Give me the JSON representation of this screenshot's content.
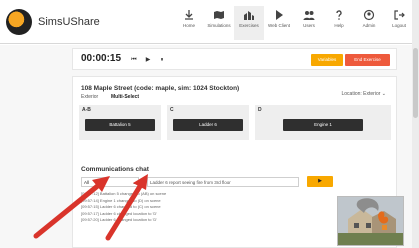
{
  "app": {
    "brand": "SimsUShare"
  },
  "nav": {
    "items": [
      {
        "label": "Home",
        "icon": "download-icon"
      },
      {
        "label": "Simulations",
        "icon": "map-icon"
      },
      {
        "label": "Exercises",
        "icon": "buildings-icon",
        "active": true
      },
      {
        "label": "Web Client",
        "icon": "play-icon"
      },
      {
        "label": "Users",
        "icon": "users-icon"
      },
      {
        "label": "Help",
        "icon": "help-icon"
      },
      {
        "label": "Admin",
        "icon": "admin-icon"
      },
      {
        "label": "Logout",
        "icon": "logout-icon"
      }
    ]
  },
  "timer": {
    "time": "00:00:15",
    "controls": {
      "rewind": "⏮",
      "play": "▶",
      "pause": "⏸"
    },
    "variables_label": "Variables",
    "end_label": "End Exercise"
  },
  "scenario": {
    "title": "108 Maple Street (code: maple, sim: 1024 Stockton)",
    "tabs": [
      "Exterior",
      "Multi-Select"
    ],
    "location_label": "Location: Exterior",
    "columns": [
      {
        "header": "A-B",
        "unit": "Battalion 5"
      },
      {
        "header": "C",
        "unit": "Ladder 6"
      },
      {
        "header": "D",
        "unit": "Engine 1"
      }
    ]
  },
  "chat": {
    "title": "Communications chat",
    "recipient": "All",
    "input_value": "Ladder 6 report seeing fire from 3rd floor",
    "send_label": "▶",
    "messages": [
      "[09:57:12] Battalion 5 changed to (AB) on scene",
      "[09:57:14] Engine 1 changed to (D) on scene",
      "[09:57:15] Ladder 6 changed to (C) on scene",
      "[09:57:17] Ladder 6 changed location to 'D'",
      "[09:57:20] Ladder 6 changed location to 'D'"
    ]
  },
  "colors": {
    "accent_orange": "#f8a800",
    "end_red": "#ee5a3c",
    "arrow_red": "#d9342b",
    "unit_dark": "#2f2f2f"
  }
}
